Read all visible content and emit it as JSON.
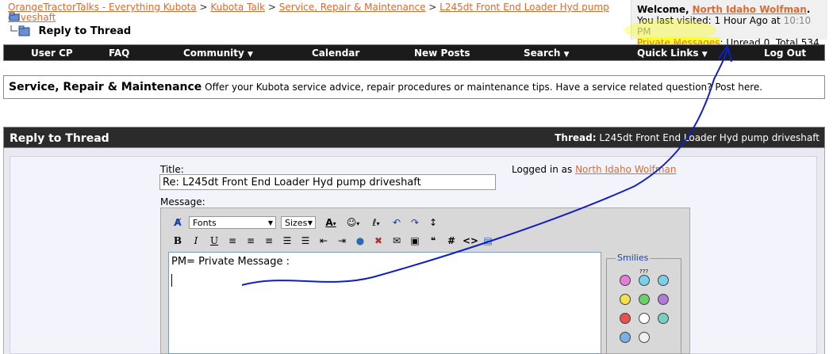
{
  "breadcrumb": {
    "items": [
      "OrangeTractorTalks - Everything Kubota",
      "Kubota Talk",
      "Service, Repair & Maintenance",
      "L245dt Front End Loader Hyd pump driveshaft"
    ],
    "separator": ">",
    "current": "Reply to Thread"
  },
  "welcome": {
    "greeting": "Welcome,",
    "username": "North Idaho Wolfman",
    "period": ".",
    "last_visited": "You last visited: 1 Hour Ago at",
    "time": "10:10 PM",
    "pm_link": "Private Messages",
    "pm_status": ": Unread 0, Total 534."
  },
  "navbar": {
    "items": [
      "User CP",
      "FAQ",
      "Community",
      "Calendar",
      "New Posts",
      "Search",
      "Quick Links",
      "Log Out"
    ]
  },
  "forum": {
    "name": "Service, Repair & Maintenance",
    "description": "Offer your Kubota service advice, repair procedures or maintenance tips. Have a service related question? Post here."
  },
  "panel": {
    "title": "Reply to Thread",
    "thread_label": "Thread:",
    "thread_name": "L245dt Front End Loader Hyd pump driveshaft"
  },
  "form": {
    "title_label": "Title:",
    "title_value": "Re: L245dt Front End Loader Hyd pump driveshaft",
    "logged_in_label": "Logged in as",
    "logged_in_user": "North Idaho Wolfman",
    "message_label": "Message:",
    "message_text": "PM= Private Message :",
    "fonts_select": "Fonts",
    "sizes_select": "Sizes",
    "smilies_label": "Smilies"
  },
  "colors": {
    "link": "#e06a2e",
    "navbar_bg": "#1b1b1b",
    "highlight": "#ffff33",
    "annotation": "#1020c0"
  }
}
